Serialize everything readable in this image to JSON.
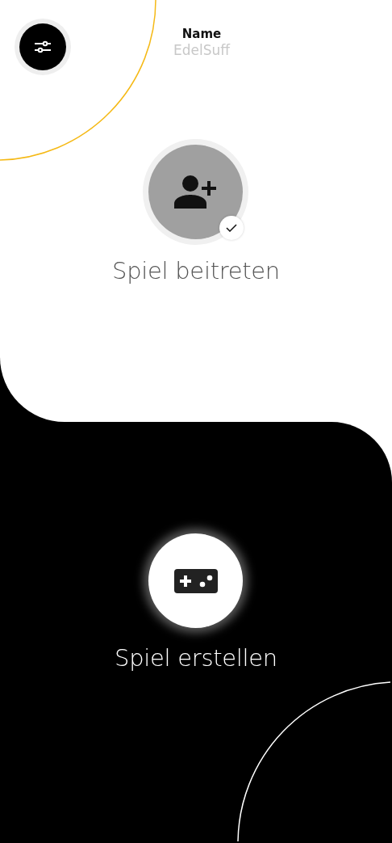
{
  "profile": {
    "label": "Name",
    "placeholder": "EdelSuff"
  },
  "actions": [
    {
      "kind": "join",
      "label": "Spiel beitreten",
      "checked": true
    },
    {
      "kind": "create",
      "label": "Spiel erstellen",
      "checked": false
    }
  ]
}
